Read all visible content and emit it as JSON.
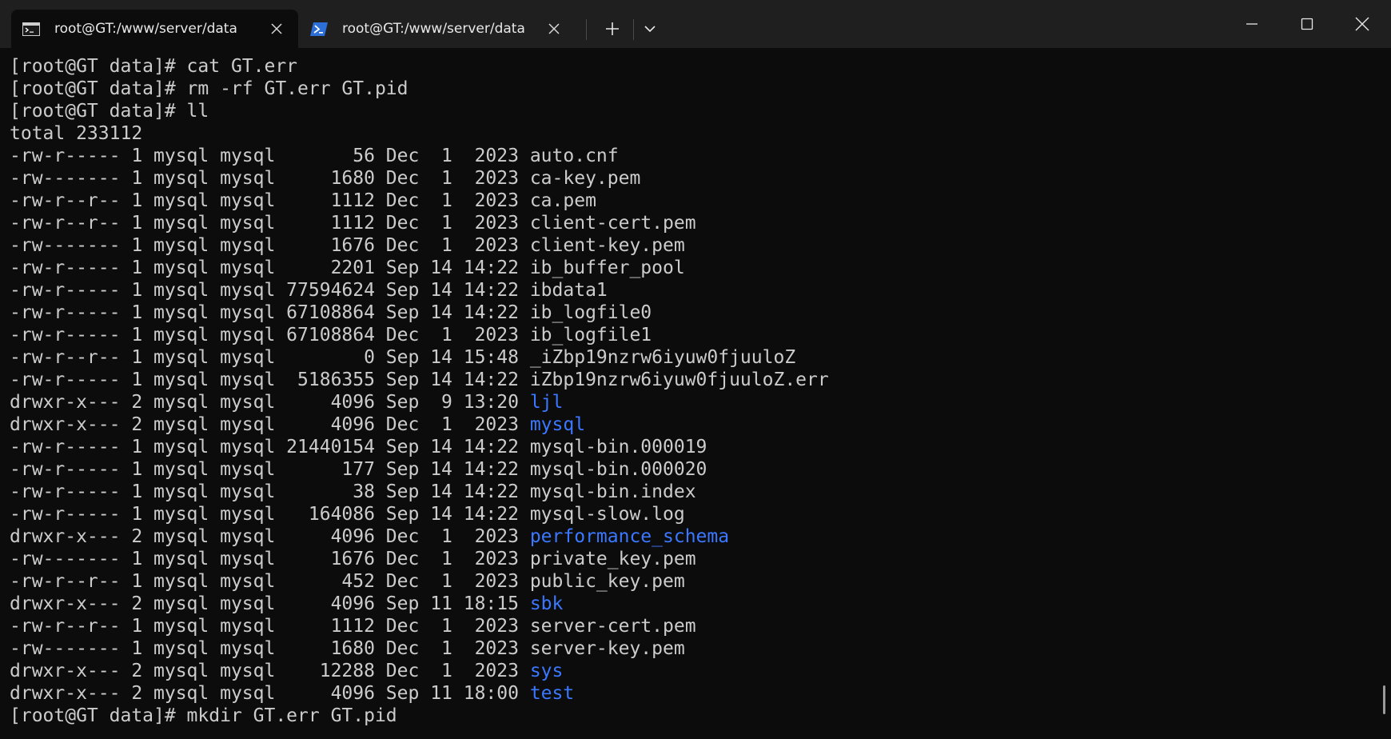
{
  "tabs": [
    {
      "title": "root@GT:/www/server/data",
      "icon": "terminal-icon",
      "active": true
    },
    {
      "title": "root@GT:/www/server/data",
      "icon": "powershell-icon",
      "active": false
    }
  ],
  "controls": {
    "new_tab": "+",
    "close": "✕"
  },
  "colors": {
    "background": "#0c0c0c",
    "titlebar": "#1f1f1f",
    "foreground": "#cccccc",
    "directory": "#3b78ff"
  },
  "terminal": {
    "lines": [
      {
        "text": "[root@GT data]# cat GT.err"
      },
      {
        "text": "[root@GT data]# rm -rf GT.err GT.pid"
      },
      {
        "text": "[root@GT data]# ll"
      },
      {
        "text": "total 233112"
      },
      {
        "text": "-rw-r----- 1 mysql mysql       56 Dec  1  2023 ",
        "name": "auto.cnf"
      },
      {
        "text": "-rw------- 1 mysql mysql     1680 Dec  1  2023 ",
        "name": "ca-key.pem"
      },
      {
        "text": "-rw-r--r-- 1 mysql mysql     1112 Dec  1  2023 ",
        "name": "ca.pem"
      },
      {
        "text": "-rw-r--r-- 1 mysql mysql     1112 Dec  1  2023 ",
        "name": "client-cert.pem"
      },
      {
        "text": "-rw------- 1 mysql mysql     1676 Dec  1  2023 ",
        "name": "client-key.pem"
      },
      {
        "text": "-rw-r----- 1 mysql mysql     2201 Sep 14 14:22 ",
        "name": "ib_buffer_pool"
      },
      {
        "text": "-rw-r----- 1 mysql mysql 77594624 Sep 14 14:22 ",
        "name": "ibdata1"
      },
      {
        "text": "-rw-r----- 1 mysql mysql 67108864 Sep 14 14:22 ",
        "name": "ib_logfile0"
      },
      {
        "text": "-rw-r----- 1 mysql mysql 67108864 Dec  1  2023 ",
        "name": "ib_logfile1"
      },
      {
        "text": "-rw-r--r-- 1 mysql mysql        0 Sep 14 15:48 ",
        "name": "_iZbp19nzrw6iyuw0fjuuloZ"
      },
      {
        "text": "-rw-r----- 1 mysql mysql  5186355 Sep 14 14:22 ",
        "name": "iZbp19nzrw6iyuw0fjuuloZ.err"
      },
      {
        "text": "drwxr-x--- 2 mysql mysql     4096 Sep  9 13:20 ",
        "name": "ljl",
        "dir": true
      },
      {
        "text": "drwxr-x--- 2 mysql mysql     4096 Dec  1  2023 ",
        "name": "mysql",
        "dir": true
      },
      {
        "text": "-rw-r----- 1 mysql mysql 21440154 Sep 14 14:22 ",
        "name": "mysql-bin.000019"
      },
      {
        "text": "-rw-r----- 1 mysql mysql      177 Sep 14 14:22 ",
        "name": "mysql-bin.000020"
      },
      {
        "text": "-rw-r----- 1 mysql mysql       38 Sep 14 14:22 ",
        "name": "mysql-bin.index"
      },
      {
        "text": "-rw-r----- 1 mysql mysql   164086 Sep 14 14:22 ",
        "name": "mysql-slow.log"
      },
      {
        "text": "drwxr-x--- 2 mysql mysql     4096 Dec  1  2023 ",
        "name": "performance_schema",
        "dir": true
      },
      {
        "text": "-rw------- 1 mysql mysql     1676 Dec  1  2023 ",
        "name": "private_key.pem"
      },
      {
        "text": "-rw-r--r-- 1 mysql mysql      452 Dec  1  2023 ",
        "name": "public_key.pem"
      },
      {
        "text": "drwxr-x--- 2 mysql mysql     4096 Sep 11 18:15 ",
        "name": "sbk",
        "dir": true
      },
      {
        "text": "-rw-r--r-- 1 mysql mysql     1112 Dec  1  2023 ",
        "name": "server-cert.pem"
      },
      {
        "text": "-rw------- 1 mysql mysql     1680 Dec  1  2023 ",
        "name": "server-key.pem"
      },
      {
        "text": "drwxr-x--- 2 mysql mysql    12288 Dec  1  2023 ",
        "name": "sys",
        "dir": true
      },
      {
        "text": "drwxr-x--- 2 mysql mysql     4096 Sep 11 18:00 ",
        "name": "test",
        "dir": true
      },
      {
        "text": "[root@GT data]# mkdir GT.err GT.pid"
      }
    ]
  }
}
